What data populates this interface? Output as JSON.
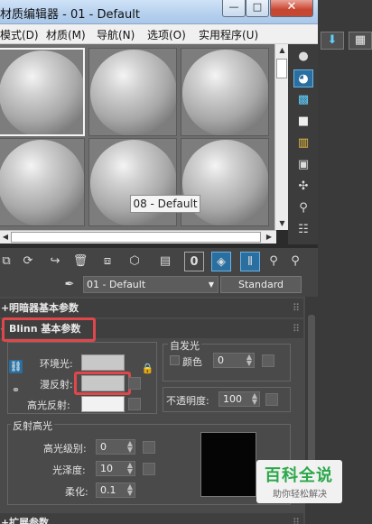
{
  "window": {
    "title": "材质编辑器 - 01 - Default",
    "controls": {
      "minimize": "—",
      "maximize": "□",
      "close": "✕"
    }
  },
  "menu": [
    "模式(D)",
    "材质(M)",
    "导航(N)",
    "选项(O)",
    "实用程序(U)"
  ],
  "slots": {
    "tooltip": "08 - Default"
  },
  "material": {
    "name": "01 - Default",
    "type": "Standard"
  },
  "rollouts": {
    "shader_basic": "明暗器基本参数",
    "blinn_basic": "Blinn 基本参数",
    "extended": "扩展参数",
    "sign_open": "-",
    "sign_closed": "+"
  },
  "blinn": {
    "ambient_label": "环境光:",
    "diffuse_label": "漫反射:",
    "specular_label": "高光反射:",
    "self_illum": {
      "title": "自发光",
      "color_label": "颜色",
      "color_value": "0"
    },
    "opacity": {
      "label": "不透明度:",
      "value": "100"
    },
    "specular_highlights": {
      "title": "反射高光",
      "level_label": "高光级别:",
      "level_value": "0",
      "gloss_label": "光泽度:",
      "gloss_value": "10",
      "soften_label": "柔化:",
      "soften_value": "0.1"
    },
    "colors": {
      "ambient": "#c8c8c8",
      "diffuse": "#c8c8c8",
      "specular": "#f2f2f2",
      "curve_preview": "#050505"
    }
  },
  "watermark": {
    "title": "百科全说",
    "subtitle": "助你轻松解决"
  },
  "accent": {
    "highlight_box": "#e0474b",
    "active_button": "#2a6fa0"
  }
}
